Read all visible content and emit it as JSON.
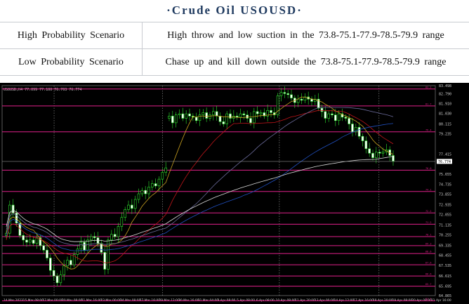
{
  "title": "·Crude  Oil  USOUSD·",
  "scenarios": [
    {
      "label": "High Probability Scenario",
      "text": "High throw and low suction in the 73.8-75.1-77.9-78.5-79.9 range"
    },
    {
      "label": "Low Probability Scenario",
      "text": "Chase up and kill down outside the 73.8-75.1-77.9-78.5-79.9 range"
    }
  ],
  "chart_data": {
    "type": "candlestick",
    "symbol_header": "USOUSD,H4  77.099 77.100 76.703 76.774",
    "y_ticks": [
      "83.498",
      "82.790",
      "81.910",
      "81.030",
      "80.115",
      "79.235",
      "77.415",
      "76.774",
      "75.655",
      "74.735",
      "73.855",
      "72.935",
      "72.055",
      "71.135",
      "70.255",
      "69.335",
      "68.455",
      "67.535",
      "66.615",
      "65.695",
      "64.865"
    ],
    "current_price": "76.774",
    "x_ticks": [
      "14 Mar 2023",
      "15 Mar 08:00",
      "17 Mar 00:00",
      "20 Mar 08:00",
      "21 Mar 16:00",
      "23 Mar 00:00",
      "24 Mar 08:00",
      "27 Mar 16:00",
      "29 Mar 12:00",
      "30 Mar 16:00",
      "31 Mar 04:00",
      "3 Apr 08:00",
      "5 Apr 08:00",
      "6 Apr 08:00",
      "10 Apr 08:00",
      "11 Apr 20:00",
      "13 Apr 00:00",
      "14 Apr 12:00",
      "17 Apr 16:00",
      "18 Apr 20:00",
      "19 Apr 08:00",
      "20 Apr 08:00",
      "21 Apr 16:00"
    ],
    "levels": [
      83.2,
      81.7,
      79.4,
      76.0,
      74.1,
      72.2,
      71.2,
      70.1,
      69.3,
      68.6,
      67.6,
      66.6,
      65.7,
      64.4
    ],
    "closes": [
      70.4,
      72.9,
      72.2,
      71.3,
      70.2,
      69.8,
      69.6,
      69.8,
      69.5,
      70.0,
      69.3,
      68.9,
      68.2,
      67.1,
      66.6,
      66.0,
      66.7,
      67.5,
      68.0,
      67.6,
      68.5,
      69.0,
      69.6,
      68.9,
      69.8,
      70.1,
      70.0,
      69.5,
      68.7,
      67.2,
      69.8,
      70.3,
      70.1,
      71.0,
      71.8,
      72.5,
      72.9,
      72.6,
      73.4,
      73.9,
      74.2,
      73.9,
      74.5,
      74.8,
      74.6,
      75.2,
      75.8,
      76.2,
      80.8,
      80.2,
      80.9,
      81.0,
      80.6,
      81.0,
      80.8,
      80.7,
      80.4,
      80.9,
      81.1,
      80.6,
      80.9,
      81.2,
      80.8,
      80.3,
      80.1,
      81.0,
      80.6,
      80.8,
      80.7,
      81.0,
      80.9,
      80.6,
      80.2,
      81.2,
      81.0,
      81.1,
      80.8,
      81.3,
      81.1,
      80.9,
      82.6,
      82.9,
      82.8,
      82.7,
      82.4,
      82.0,
      82.3,
      82.2,
      82.5,
      82.3,
      82.1,
      82.3,
      81.5,
      81.2,
      80.6,
      81.0,
      80.9,
      80.4,
      81.0,
      80.7,
      80.6,
      80.1,
      79.4,
      79.8,
      79.0,
      78.6,
      77.9,
      77.5,
      77.1,
      77.6,
      77.5,
      77.6,
      77.8,
      77.3,
      76.8
    ],
    "moving_averages": [
      {
        "color": "#c8a020"
      },
      {
        "color": "#c0151a"
      },
      {
        "color": "#6a6a9a"
      },
      {
        "color": "#2050c0"
      },
      {
        "color": "#d8d8d8"
      }
    ]
  }
}
